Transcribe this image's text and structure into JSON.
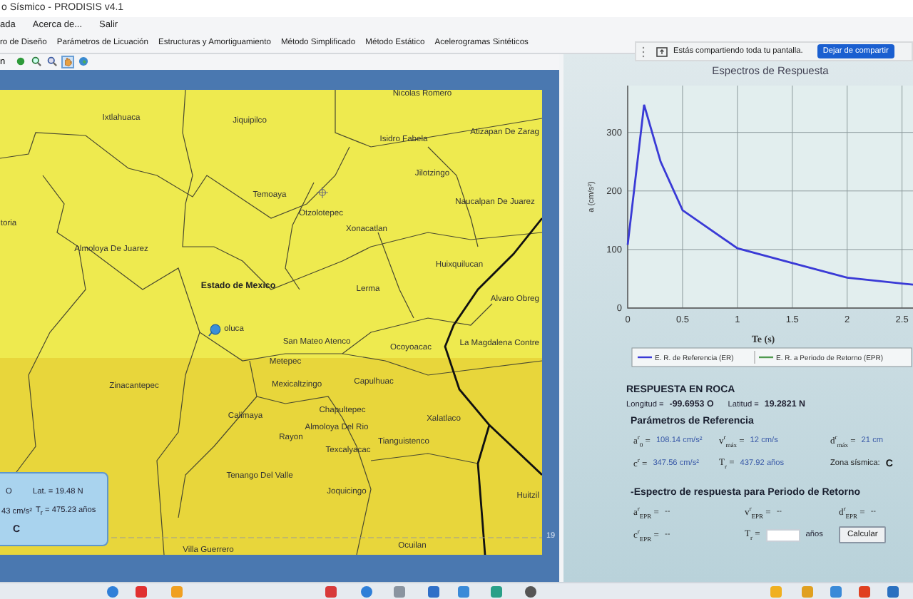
{
  "window": {
    "title": "o Sísmico - PRODISIS v4.1"
  },
  "menu": [
    "ada",
    "Acerca de...",
    "Salir"
  ],
  "tabs": [
    "ro de Diseño",
    "Parámetros de Licuación",
    "Estructuras y Amortiguamiento",
    "Método Simplificado",
    "Método Estático",
    "Acelerogramas Sintéticos"
  ],
  "toolbar": {
    "label": "n",
    "tools": [
      {
        "kind": "point",
        "selected": false
      },
      {
        "kind": "zoom_in",
        "selected": false
      },
      {
        "kind": "zoom_out",
        "selected": false
      },
      {
        "kind": "pan",
        "selected": true
      },
      {
        "kind": "globe",
        "selected": false
      }
    ]
  },
  "share_bar": {
    "message": "Estás compartiendo toda tu pantalla.",
    "button": "Dejar de compartir"
  },
  "map": {
    "places": [
      {
        "kind": "town",
        "name": "Nicolas Romero"
      },
      {
        "kind": "town",
        "name": "Ixtlahuaca"
      },
      {
        "kind": "town",
        "name": "Jiquipilco"
      },
      {
        "kind": "town",
        "name": "Atizapan De Zarag"
      },
      {
        "kind": "town",
        "name": "Isidro Fabela"
      },
      {
        "kind": "town",
        "name": "Jilotzingo"
      },
      {
        "kind": "town",
        "name": "Temoaya"
      },
      {
        "kind": "town",
        "name": "Otzolotepec"
      },
      {
        "kind": "town",
        "name": "Naucalpan De Juarez"
      },
      {
        "kind": "town",
        "name": "toria"
      },
      {
        "kind": "town",
        "name": "Xonacatlan"
      },
      {
        "kind": "town",
        "name": "Almoloya De Juarez"
      },
      {
        "kind": "town",
        "name": "Huixquilucan"
      },
      {
        "kind": "state",
        "name": "Estado de Mexico"
      },
      {
        "kind": "town",
        "name": "Lerma"
      },
      {
        "kind": "town",
        "name": "Alvaro Obreg"
      },
      {
        "kind": "town",
        "name": "oluca"
      },
      {
        "kind": "town",
        "name": "San Mateo Atenco"
      },
      {
        "kind": "town",
        "name": "Ocoyoacac"
      },
      {
        "kind": "town",
        "name": "La Magdalena Contre"
      },
      {
        "kind": "town",
        "name": "Metepec"
      },
      {
        "kind": "town",
        "name": "Zinacantepec"
      },
      {
        "kind": "town",
        "name": "Mexicaltzingo"
      },
      {
        "kind": "town",
        "name": "Capulhuac"
      },
      {
        "kind": "town",
        "name": "Calimaya"
      },
      {
        "kind": "town",
        "name": "Chapultepec"
      },
      {
        "kind": "town",
        "name": "Xalatlaco"
      },
      {
        "kind": "town",
        "name": "Almoloya Del Rio"
      },
      {
        "kind": "town",
        "name": "Rayon"
      },
      {
        "kind": "town",
        "name": "Tianguistenco"
      },
      {
        "kind": "town",
        "name": "Texcalyacac"
      },
      {
        "kind": "town",
        "name": "Tenango Del Valle"
      },
      {
        "kind": "town",
        "name": "Joquicingo"
      },
      {
        "kind": "town",
        "name": "Huitzil"
      },
      {
        "kind": "town",
        "name": "Villa Guerrero"
      },
      {
        "kind": "town",
        "name": "Ocuilan"
      }
    ],
    "grid_label": "19",
    "info_box": {
      "longitude": "O",
      "latitude": "Lat. = 19.48 N",
      "acceleration": "43 cm/s²",
      "return_period": "T$_{r}$ = 475.23 años",
      "zone": "C"
    }
  },
  "chart_data": {
    "type": "line",
    "title": "Espectros de Respuesta",
    "xlabel": "Te (s)",
    "ylabel": "a (cm/s²)",
    "x": [
      0,
      0.15,
      0.3,
      0.5,
      1,
      1.5,
      2,
      2.6
    ],
    "series": [
      {
        "name": "E. R. de Referencia (ER)",
        "color": "#3a3ad6",
        "values": [
          108,
          347,
          250,
          167,
          102,
          77,
          52,
          40
        ]
      },
      {
        "name": "E. R. a Periodo de Retorno (EPR)",
        "color": "#4f9a4f",
        "values": [
          null,
          null,
          null,
          null,
          null,
          null,
          null,
          null
        ]
      }
    ],
    "grid": true,
    "xlim": [
      0,
      2.6
    ],
    "ylim": [
      0,
      380
    ],
    "xticks": [
      0,
      0.5,
      1,
      1.5,
      2,
      2.5
    ],
    "yticks": [
      0,
      100,
      200,
      300
    ]
  },
  "results": {
    "title": "RESPUESTA EN ROCA",
    "location": [
      {
        "label": "Longitud =",
        "value": "-99.6953 O"
      },
      {
        "label": "Latitud =",
        "value": "19.2821 N"
      }
    ],
    "reference": {
      "title": "Parámetros de Referencia",
      "rows": [
        [
          {
            "kind": "param",
            "symbol": "a$^{r}$$_{0}$ =",
            "value": "108.14 cm/s²"
          },
          {
            "kind": "param",
            "symbol": "v$^{r}$$_{máx}$ =",
            "value": "12 cm/s"
          },
          {
            "kind": "param",
            "symbol": "d$^{r}$$_{máx}$ =",
            "value": "21 cm"
          }
        ],
        [
          {
            "kind": "param",
            "symbol": "c$^{r}$ =",
            "value": "347.56 cm/s²"
          },
          {
            "kind": "param",
            "symbol": "T$_{r}$ =",
            "value": "437.92 años"
          },
          {
            "kind": "zone",
            "symbol": "Zona sísmica:",
            "value": "C"
          }
        ]
      ]
    },
    "return_period": {
      "title": "-Espectro de respuesta para Periodo de Retorno",
      "rows": [
        [
          {
            "kind": "empty",
            "symbol": "a$^{r}$$_{EPR}$ =",
            "value": "--"
          },
          {
            "kind": "empty",
            "symbol": "v$^{r}$$_{EPR}$ =",
            "value": "--"
          },
          {
            "kind": "empty",
            "symbol": "d$^{r}$$_{EPR}$ =",
            "value": "--"
          }
        ],
        [
          {
            "kind": "empty",
            "symbol": "c$^{r}$$_{EPR}$ =",
            "value": "--"
          },
          {
            "kind": "input",
            "symbol": "T$_{r}$ =",
            "unit": "años"
          },
          {
            "kind": "button",
            "label": "Calcular"
          }
        ]
      ]
    }
  }
}
